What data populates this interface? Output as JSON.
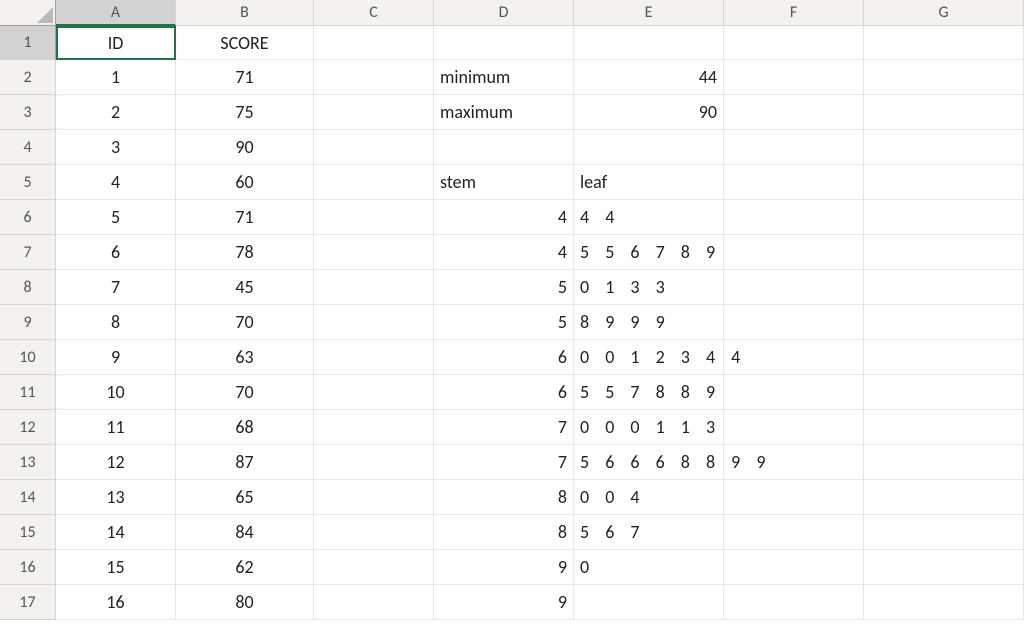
{
  "headers": [
    "A",
    "B",
    "C",
    "D",
    "E",
    "F",
    "G"
  ],
  "row_numbers": [
    1,
    2,
    3,
    4,
    5,
    6,
    7,
    8,
    9,
    10,
    11,
    12,
    13,
    14,
    15,
    16,
    17
  ],
  "selected": {
    "row": 1,
    "col": "A"
  },
  "col_a_label": "ID",
  "col_b_label": "SCORE",
  "ids": [
    1,
    2,
    3,
    4,
    5,
    6,
    7,
    8,
    9,
    10,
    11,
    12,
    13,
    14,
    15,
    16
  ],
  "scores": [
    71,
    75,
    90,
    60,
    71,
    78,
    45,
    70,
    63,
    70,
    68,
    87,
    65,
    84,
    62,
    80
  ],
  "summary": {
    "minimum_label": "minimum",
    "minimum_value": 44,
    "maximum_label": "maximum",
    "maximum_value": 90
  },
  "stemleaf": {
    "stem_label": "stem",
    "leaf_label": "leaf",
    "rows": [
      {
        "stem": 4,
        "leaf": "4 4"
      },
      {
        "stem": 4,
        "leaf": "5 5 6 7 8 9"
      },
      {
        "stem": 5,
        "leaf": "0 1 3 3"
      },
      {
        "stem": 5,
        "leaf": "8 9 9 9"
      },
      {
        "stem": 6,
        "leaf": "0 0 1 2 3 4 4"
      },
      {
        "stem": 6,
        "leaf": "5 5 7 8 8 9"
      },
      {
        "stem": 7,
        "leaf": "0 0 0 1 1 3"
      },
      {
        "stem": 7,
        "leaf": "5 6 6 6 8 8 9 9"
      },
      {
        "stem": 8,
        "leaf": "0 0 4"
      },
      {
        "stem": 8,
        "leaf": "5 6 7"
      },
      {
        "stem": 9,
        "leaf": "0"
      },
      {
        "stem": 9,
        "leaf": ""
      }
    ]
  }
}
